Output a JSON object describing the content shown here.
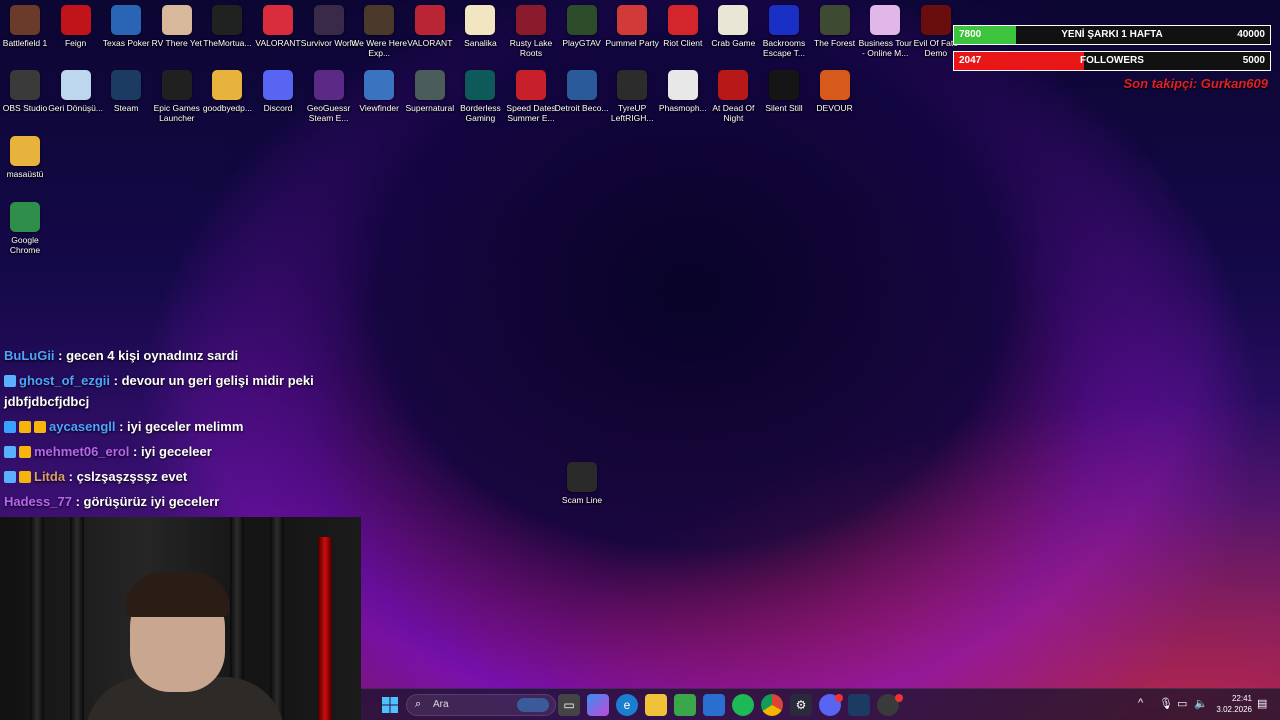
{
  "desktop": {
    "row1": [
      {
        "name": "Battlefield 1",
        "color": "#6a3b2a"
      },
      {
        "name": "Feign",
        "color": "#c0141a"
      },
      {
        "name": "Texas Poker",
        "color": "#2a65b5"
      },
      {
        "name": "RV There Yet",
        "color": "#d8b89b"
      },
      {
        "name": "TheMortua...",
        "color": "#1f2220"
      },
      {
        "name": "VALORANT",
        "color": "#d92d3e"
      },
      {
        "name": "Survivor World",
        "color": "#3a2a4a"
      },
      {
        "name": "We Were Here Exp...",
        "color": "#4b3a2c"
      },
      {
        "name": "VALORANT",
        "color": "#b92535"
      },
      {
        "name": "Sanalika",
        "color": "#f2e6c2"
      },
      {
        "name": "Rusty Lake Roots",
        "color": "#8b1b2c"
      },
      {
        "name": "PlayGTAV",
        "color": "#2d4d2a"
      },
      {
        "name": "Pummel Party",
        "color": "#d23a3a"
      },
      {
        "name": "Riot Client",
        "color": "#d2262c"
      },
      {
        "name": "Crab Game",
        "color": "#e8e6d5"
      },
      {
        "name": "Backrooms Escape T...",
        "color": "#1a2fc4"
      },
      {
        "name": "The Forest",
        "color": "#3e4a32"
      },
      {
        "name": "Business Tour - Online M...",
        "color": "#e0b7e8"
      },
      {
        "name": "Evil Of Fate Demo",
        "color": "#6a0d0d"
      }
    ],
    "row2": [
      {
        "name": "OBS Studio",
        "color": "#3a3a3a"
      },
      {
        "name": "Geri Dönüşü...",
        "color": "#bcd7ee"
      },
      {
        "name": "Steam",
        "color": "#1b3b63"
      },
      {
        "name": "Epic Games Launcher",
        "color": "#202020"
      },
      {
        "name": "goodbyedp...",
        "color": "#e8b33c"
      },
      {
        "name": "Discord",
        "color": "#5865f2"
      },
      {
        "name": "GeoGuessr Steam E...",
        "color": "#5b2a86"
      },
      {
        "name": "Viewfinder",
        "color": "#3a73c0"
      },
      {
        "name": "Supernatural",
        "color": "#4a5d5a"
      },
      {
        "name": "Borderless Gaming",
        "color": "#0e5a5a"
      },
      {
        "name": "Speed Dates Summer E...",
        "color": "#c8202a"
      },
      {
        "name": "Detroit Beco...",
        "color": "#2a5a9a"
      },
      {
        "name": "TyreUP LeftRIGH...",
        "color": "#2c2c2c"
      },
      {
        "name": "Phasmoph...",
        "color": "#e8e8e8"
      },
      {
        "name": "At Dead Of Night",
        "color": "#b81818"
      },
      {
        "name": "Silent Still",
        "color": "#151515"
      },
      {
        "name": "DEVOUR",
        "color": "#d85a1a"
      }
    ],
    "col": [
      {
        "name": "masaüstü",
        "color": "#e8b33c"
      },
      {
        "name": "Google Chrome",
        "color": "#2f8f4a"
      }
    ],
    "center_icon": {
      "name": "Scam Line",
      "color": "#2a2a2a"
    }
  },
  "chat": [
    {
      "user": "BuLuGii",
      "text": ": gecen 4 kişi oynadınız sardi",
      "color": "#4ea3ff",
      "badges": []
    },
    {
      "user": "ghost_of_ezgii",
      "text": ": devour un geri gelişi midir peki jdbfjdbcfjdbcj",
      "color": "#4ea3ff",
      "badges": [
        "#5ab0ff"
      ]
    },
    {
      "user": "aycasengll",
      "text": ": iyi geceler melimm",
      "color": "#4ea3ff",
      "badges": [
        "#3aa0ff",
        "#f5b50c",
        "#f5b50c"
      ]
    },
    {
      "user": "mehmet06_erol",
      "text": ": iyi geceleer",
      "color": "#b766f0",
      "badges": [
        "#5ab0ff",
        "#f5b50c"
      ]
    },
    {
      "user": "Litda",
      "text": ": çslzşaşzşsşz evet",
      "color": "#d8a06a",
      "badges": [
        "#5ab0ff",
        "#f5b50c"
      ]
    },
    {
      "user": "Hadess_77",
      "text": ": görüşürüz iyi gecelerr",
      "color": "#b766f0",
      "badges": []
    }
  ],
  "overlay": {
    "songs": {
      "value": "7800",
      "label": "YENİ ŞARKI 1 HAFTA",
      "goal": "40000",
      "fill": 0.195,
      "color": "#3cc43c"
    },
    "followers": {
      "value": "2047",
      "label": "FOLLOWERS",
      "goal": "5000",
      "fill": 0.41,
      "color": "#e81616"
    },
    "last_follower": "Son takipçi: Gurkan609"
  },
  "taskbar": {
    "search_placeholder": "Ara",
    "time": "22:41",
    "date": "3.02.2026"
  }
}
